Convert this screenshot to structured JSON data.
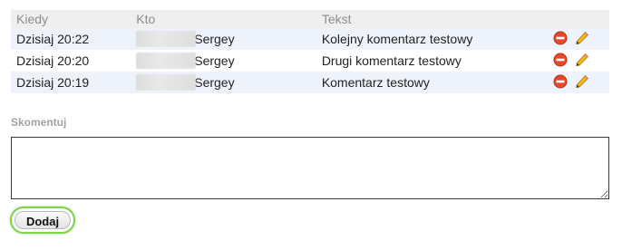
{
  "table": {
    "headers": {
      "when": "Kiedy",
      "who": "Kto",
      "text": "Tekst"
    },
    "rows": [
      {
        "when": "Dzisiaj 20:22",
        "who": "Sergey",
        "text": "Kolejny komentarz testowy"
      },
      {
        "when": "Dzisiaj 20:20",
        "who": "Sergey",
        "text": "Drugi komentarz testowy"
      },
      {
        "when": "Dzisiaj 20:19",
        "who": "Sergey",
        "text": "Komentarz testowy"
      }
    ],
    "row_actions": [
      "delete-icon",
      "edit-pencil-icon"
    ]
  },
  "form": {
    "label": "Skomentuj",
    "textarea_value": "",
    "submit_label": "Dodaj"
  },
  "colors": {
    "header_bg": "#efefef",
    "header_text": "#8d8d8d",
    "row_alt_bg": "#eef3fb",
    "delete_red": "#e8472a",
    "pencil_yellow": "#f2b81d",
    "button_focus_green": "#7fd34b"
  }
}
